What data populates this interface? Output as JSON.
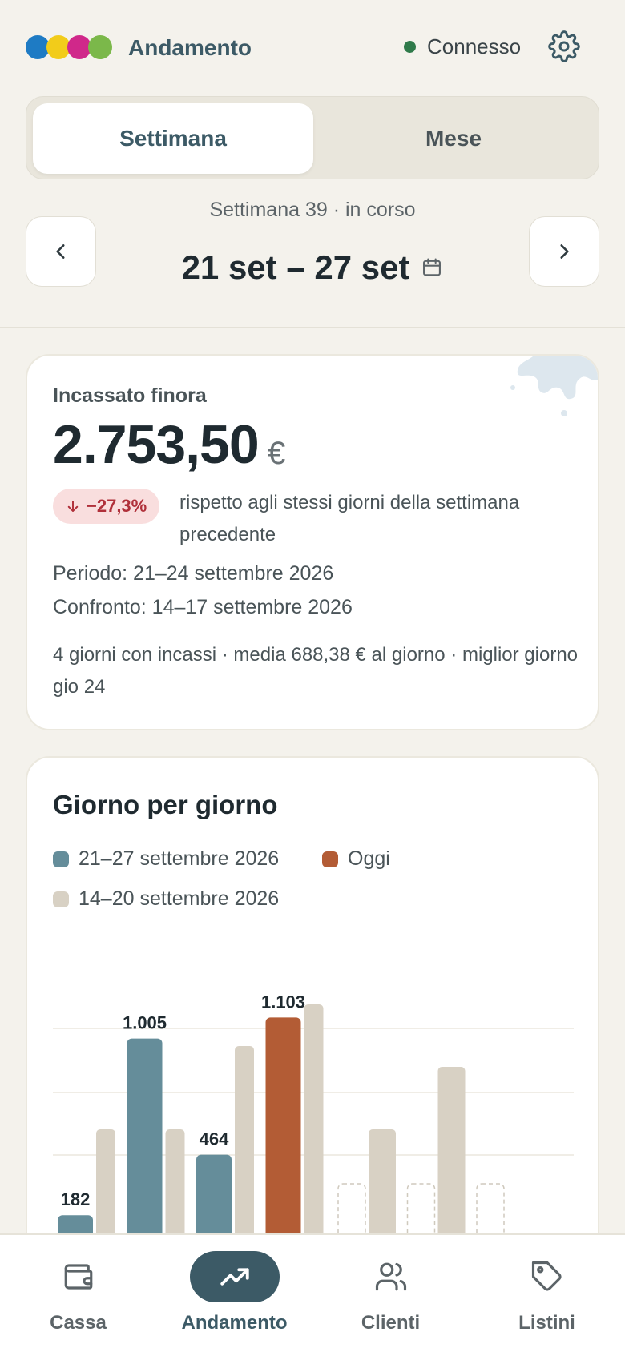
{
  "header": {
    "logo_colors": [
      "#1e7bc4",
      "#f2cc1a",
      "#d0288a",
      "#7bb84a"
    ],
    "title": "Andamento",
    "status_label": "Connesso",
    "status_color": "#2f7a4a",
    "settings_icon": "gear-icon"
  },
  "segmented": {
    "options": [
      "Settimana",
      "Mese"
    ],
    "selected": "Settimana"
  },
  "week": {
    "subtitle": "Settimana 39 · in corso",
    "range": "21 set – 27 set",
    "prev_icon": "chevron-left-icon",
    "next_icon": "chevron-right-icon",
    "calendar_icon": "calendar-icon"
  },
  "summary": {
    "label": "Incassato finora",
    "amount": "2.753,50",
    "currency": "€",
    "delta": "−27,3%",
    "delta_color": "#b0303a",
    "compare_text": "rispetto agli stessi giorni della settimana precedente",
    "period": "Periodo: 21–24 settembre 2026",
    "comparison": "Confronto: 14–17 settembre 2026",
    "stats": "4 giorni con incassi · media 688,38 € al giorno · miglior giorno gio 24"
  },
  "chart_card": {
    "title": "Giorno per giorno",
    "legend": [
      {
        "label": "21–27 settembre 2026",
        "color": "#658d9a"
      },
      {
        "label": "Oggi",
        "color": "#b35c35"
      },
      {
        "label": "14–20 settembre 2026",
        "color": "#d8d1c4"
      }
    ]
  },
  "chart_data": {
    "type": "bar",
    "grid": true,
    "series": [
      {
        "name": "21–27 settembre 2026",
        "values": [
          182,
          1005,
          464,
          1103,
          null,
          null,
          null
        ]
      },
      {
        "name": "14–20 settembre 2026",
        "values": [
          600,
          600,
          1000,
          1200,
          600,
          900,
          null
        ]
      }
    ],
    "data_labels": [
      "182",
      "1.005",
      "464",
      "1.103"
    ],
    "today_index": 3,
    "colors": {
      "current": "#658d9a",
      "today": "#b35c35",
      "previous": "#d8d1c4",
      "empty": "#cfc9bd"
    }
  },
  "tabbar": {
    "tabs": [
      {
        "label": "Cassa",
        "icon": "wallet-icon"
      },
      {
        "label": "Andamento",
        "icon": "trend-up-icon"
      },
      {
        "label": "Clienti",
        "icon": "users-icon"
      },
      {
        "label": "Listini",
        "icon": "tag-icon"
      }
    ],
    "active": "Andamento"
  }
}
